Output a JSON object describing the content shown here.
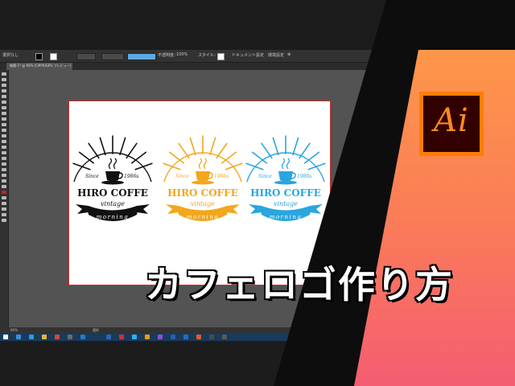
{
  "title_text": "カフェロゴ作り方",
  "ai_logo": {
    "label": "Ai",
    "frame_color": "#ff7c00",
    "bg_color": "#330000"
  },
  "control_bar": {
    "panel_label": "選択なし",
    "opacity_label": "不透明度：",
    "opacity_value": "100%",
    "style_label": "スタイル：",
    "doc_settings": "ドキュメント設定",
    "prefs": "環境設定"
  },
  "document_tab": {
    "label": "無題-1* @ 66% (CMYK/GPU プレビュー)"
  },
  "status_bar": {
    "zoom": "66%",
    "tool": "選択"
  },
  "logos": [
    {
      "color": "#111111",
      "since": "Since",
      "year": "1986s",
      "brand": "HIRO COFFE",
      "tagline": "vintage",
      "banner": "morning"
    },
    {
      "color": "#f2a71d",
      "since": "Since",
      "year": "1986s",
      "brand": "HIRO COFFE",
      "tagline": "vintage",
      "banner": "morning"
    },
    {
      "color": "#29a6de",
      "since": "Since",
      "year": "1986s",
      "brand": "HIRO COFFE",
      "tagline": "vintage",
      "banner": "morning"
    }
  ],
  "colors": {
    "gradient_top": "#ff9f45",
    "gradient_bottom": "#f45d72",
    "artboard_border": "#c9302c",
    "workspace": "#535353"
  }
}
